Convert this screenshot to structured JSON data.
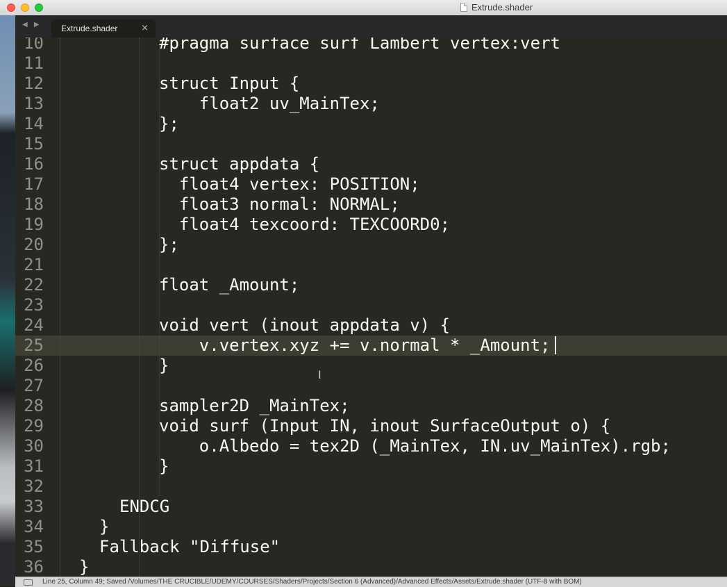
{
  "window": {
    "title": "Extrude.shader"
  },
  "tabs": [
    {
      "label": "Extrude.shader",
      "close": "×"
    }
  ],
  "tab_nav": "◀ ▶",
  "editor": {
    "current_line": 25,
    "lines": [
      {
        "num": "10",
        "text": "#pragma surface surf Lambert vertex:vert"
      },
      {
        "num": "11",
        "text": ""
      },
      {
        "num": "12",
        "text": "struct Input {"
      },
      {
        "num": "13",
        "text": "    float2 uv_MainTex;"
      },
      {
        "num": "14",
        "text": "};"
      },
      {
        "num": "15",
        "text": ""
      },
      {
        "num": "16",
        "text": "struct appdata {"
      },
      {
        "num": "17",
        "text": "  float4 vertex: POSITION;"
      },
      {
        "num": "18",
        "text": "  float3 normal: NORMAL;"
      },
      {
        "num": "19",
        "text": "  float4 texcoord: TEXCOORD0;"
      },
      {
        "num": "20",
        "text": "};"
      },
      {
        "num": "21",
        "text": ""
      },
      {
        "num": "22",
        "text": "float _Amount;"
      },
      {
        "num": "23",
        "text": ""
      },
      {
        "num": "24",
        "text": "void vert (inout appdata v) {"
      },
      {
        "num": "25",
        "text": "    v.vertex.xyz += v.normal * _Amount;"
      },
      {
        "num": "26",
        "text": "}"
      },
      {
        "num": "27",
        "text": ""
      },
      {
        "num": "28",
        "text": "sampler2D _MainTex;"
      },
      {
        "num": "29",
        "text": "void surf (Input IN, inout SurfaceOutput o) {"
      },
      {
        "num": "30",
        "text": "    o.Albedo = tex2D (_MainTex, IN.uv_MainTex).rgb;"
      },
      {
        "num": "31",
        "text": "}"
      },
      {
        "num": "32",
        "text": ""
      },
      {
        "num": "33",
        "text": "ENDCG"
      },
      {
        "num": "34",
        "text": "}"
      },
      {
        "num": "35",
        "text": "Fallback \"Diffuse\""
      },
      {
        "num": "36",
        "text": "}"
      }
    ]
  },
  "status_bar": {
    "text": "Line 25, Column 49; Saved /Volumes/THE CRUCIBLE/UDEMY/COURSES/Shaders/Projects/Section 6 (Advanced)/Advanced Effects/Assets/Extrude.shader (UTF-8 with BOM)"
  },
  "colors": {
    "editor_bg": "#272822",
    "current_line_bg": "#3e3d32",
    "text": "#f8f8f2",
    "gutter_text": "#8f908a"
  }
}
